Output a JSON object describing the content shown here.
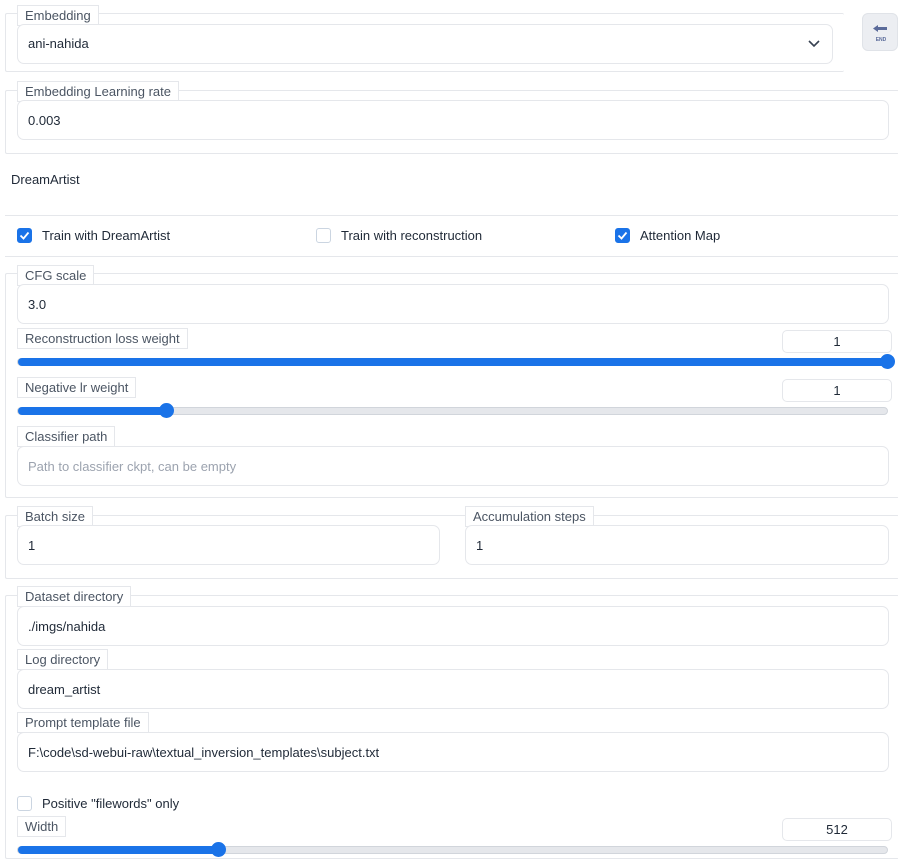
{
  "embedding": {
    "label": "Embedding",
    "value": "ani-nahida",
    "back_icon": "end-back-icon",
    "back_text": "END"
  },
  "embedding_lr": {
    "label": "Embedding Learning rate",
    "value": "0.003"
  },
  "section_title": "DreamArtist",
  "checkboxes": [
    {
      "label": "Train with DreamArtist",
      "checked": true
    },
    {
      "label": "Train with reconstruction",
      "checked": false
    },
    {
      "label": "Attention Map",
      "checked": true
    }
  ],
  "cfg_scale": {
    "label": "CFG scale",
    "value": "3.0"
  },
  "recon_loss": {
    "label": "Reconstruction loss weight",
    "value": "1",
    "fraction": 1.0
  },
  "neg_lr": {
    "label": "Negative lr weight",
    "value": "1",
    "fraction": 0.17
  },
  "classifier": {
    "label": "Classifier path",
    "placeholder": "Path to classifier ckpt, can be empty",
    "value": ""
  },
  "batch_size": {
    "label": "Batch size",
    "value": "1"
  },
  "accum_steps": {
    "label": "Accumulation steps",
    "value": "1"
  },
  "dataset_dir": {
    "label": "Dataset directory",
    "value": "./imgs/nahida"
  },
  "log_dir": {
    "label": "Log directory",
    "value": "dream_artist"
  },
  "prompt_template": {
    "label": "Prompt template file",
    "value": "F:\\code\\sd-webui-raw\\textual_inversion_templates\\subject.txt"
  },
  "positive_filewords": {
    "label": "Positive \"filewords\" only",
    "checked": false
  },
  "width": {
    "label": "Width",
    "value": "512",
    "fraction": 0.23
  },
  "colors": {
    "accent": "#1a73e8",
    "border": "#e5e7eb",
    "back_icon": "#5b6b9a"
  }
}
